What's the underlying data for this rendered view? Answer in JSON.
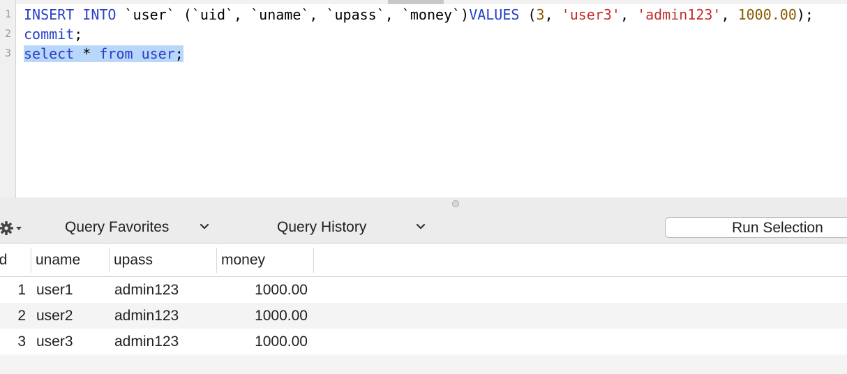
{
  "editor": {
    "line_numbers": [
      "1",
      "2",
      "3"
    ],
    "line1": {
      "insert_kw": "INSERT INTO",
      "tbl": " `user` (`uid`, `uname`, `upass`, `money`)",
      "values_kw": "VALUES",
      "open": " (",
      "n1": "3",
      "c1": ", ",
      "s1": "'user3'",
      "c2": ", ",
      "s2": "'admin123'",
      "c3": ", ",
      "n2": "1000.00",
      "close": ");"
    },
    "line2": {
      "commit_kw": "commit",
      "semi": ";"
    },
    "line3": {
      "select_kw": "select",
      "star": " * ",
      "from_kw": "from",
      "tbl": " user",
      "semi": ";"
    }
  },
  "toolbar": {
    "gear_icon": "gear-icon",
    "query_favorites_label": "Query Favorites",
    "query_history_label": "Query History",
    "run_selection_label": "Run Selection"
  },
  "results": {
    "columns": [
      "id",
      "uname",
      "upass",
      "money"
    ],
    "rows": [
      {
        "uid": "1",
        "uname": "user1",
        "upass": "admin123",
        "money": "1000.00"
      },
      {
        "uid": "2",
        "uname": "user2",
        "upass": "admin123",
        "money": "1000.00"
      },
      {
        "uid": "3",
        "uname": "user3",
        "upass": "admin123",
        "money": "1000.00"
      }
    ]
  },
  "colors": {
    "keyword": "#2740c8",
    "string": "#c22e2e",
    "number": "#8a5a00",
    "selection": "#b9d7fb"
  }
}
